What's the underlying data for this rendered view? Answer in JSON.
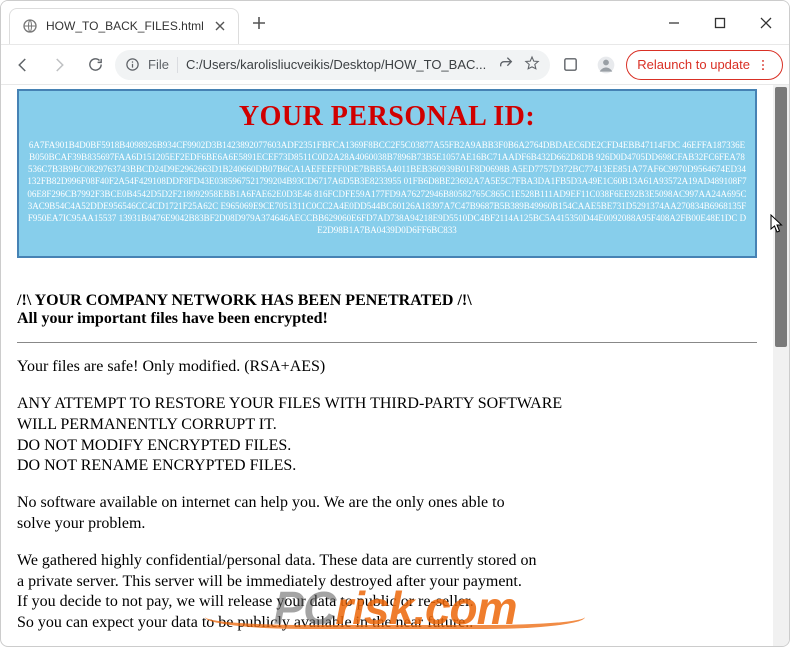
{
  "window": {
    "tab_title": "HOW_TO_BACK_FILES.html",
    "address_prefix": "File",
    "address_path": "C:/Users/karolisliucveikis/Desktop/HOW_TO_BAC...",
    "relaunch_label": "Relaunch to update"
  },
  "ransom": {
    "id_header": "YOUR PERSONAL ID:",
    "id_lines": [
      "6A7FA901B4D0BF5918B4098926B934CF9902D3B1423892077603ADF2351FBFCA1369F8BCC2F5C03877A55FB2A9ABB3F0B6A2764DBDAEC6DE2CFD4EBB47114FDC",
      "46EFFA187336EB050BCAF39B835697FAA6D151205EF2EDF6BE6A6E5891ECEF73D8511C0D2A28A4060038B7896B73B5E1057AE16BC71AADF6B432D662D8DB",
      "926D0D4705DD698CFAB32FC6FEA78536C7B3B9BC0829763743BBCD24D9E2962663D1B240660DB07B6CA1AEFEEFF0DE7BBB5A4011BEB360939B01F8D0698B",
      "A5ED7757D372BC77413EE851A77AF6C9970D9564674ED34132FB82D996F08F40F2A54F429108DDF8FD43E0385967521799204B93CD6717A6D5B3E8233955",
      "01FB6D8BE23692A7A5E5C7FBA3DA1FB5D3A49E1C60B13A61A93572A19AD489108F706E8F296CB7992F3BCE0B4542D5D2F218092958EBB1A6FAE62E0D3E46",
      "816FCDFE59A177FD9A76272946B80582765C865C1E528B111AD9EF11C038F6EE92B3E5098AC997AA24A695C3AC9B54C4A52DDE956546CC4CD1721F25A62C",
      "E965069E9CE7051311C0CC2A4E0DD544BC60126A18397A7C47B9687B5B389B49960B154CAAE5BE731D5291374AA270834B6968135FF950EA7IC95AA15537",
      "13931B0476E9042B83BF2D08D979A374646AECCBB629060E6FD7AD738A94218E9D5510DC4BF2114A125BC5A415350D44E0092088A95F408A2FB00E48E1DC",
      "DE2D98B1A7BA0439D0D6FF6BC833"
    ],
    "warning_heading": "/!\\ YOUR COMPANY NETWORK HAS BEEN PENETRATED /!\\",
    "encrypted_line": "All your important files have been encrypted!",
    "safe_line": "Your files are safe! Only modified. (RSA+AES)",
    "attempt_l1": "ANY ATTEMPT TO RESTORE YOUR FILES WITH THIRD-PARTY SOFTWARE",
    "attempt_l2": "WILL PERMANENTLY CORRUPT IT.",
    "attempt_l3": "DO NOT MODIFY ENCRYPTED FILES.",
    "attempt_l4": "DO NOT RENAME ENCRYPTED FILES.",
    "nosoft_l1": "No software available on internet can help you. We are the only ones able to",
    "nosoft_l2": "solve your problem.",
    "gather_l1": "We gathered highly confidential/personal data. These data are currently stored on",
    "gather_l2": "a private server. This server will be immediately destroyed after your payment.",
    "gather_l3": "If you decide to not pay, we will release your data to public or re-seller.",
    "gather_l4": "So you can expect your data to be publicly available in the near future.."
  },
  "watermark": {
    "pc": "PC",
    "risk": "risk.com"
  }
}
